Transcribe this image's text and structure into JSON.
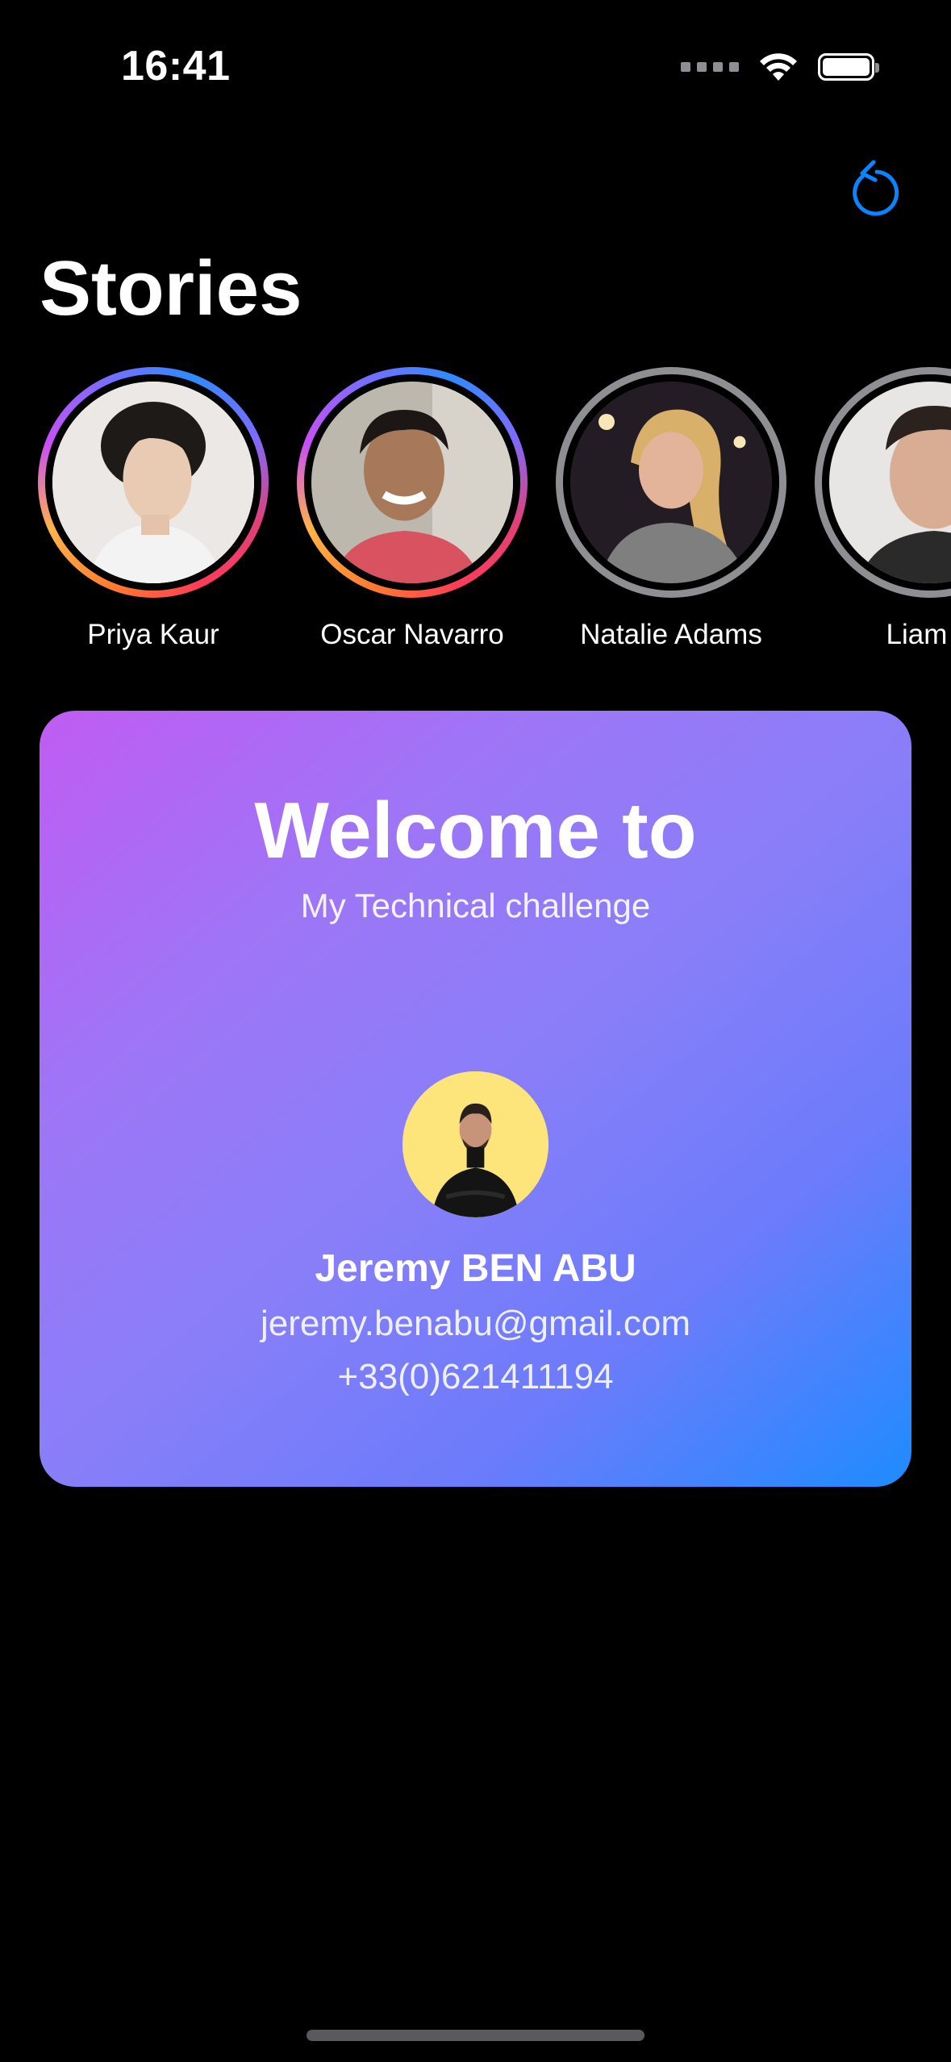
{
  "status_bar": {
    "time": "16:41"
  },
  "header": {
    "refresh_icon": "arrow-counterclockwise-icon",
    "title": "Stories"
  },
  "stories": [
    {
      "name": "Priya Kaur",
      "seen": false
    },
    {
      "name": "Oscar Navarro",
      "seen": false
    },
    {
      "name": "Natalie Adams",
      "seen": true
    },
    {
      "name": "Liam P",
      "seen": true
    }
  ],
  "welcome_card": {
    "title": "Welcome to",
    "subtitle": "My Technical challenge",
    "profile": {
      "name": "Jeremy BEN ABU",
      "email": "jeremy.benabu@gmail.com",
      "phone": "+33(0)621411194"
    }
  },
  "colors": {
    "background": "#000000",
    "accent": "#0a84ff",
    "card_gradient_start": "#c05cf2",
    "card_gradient_end": "#1e8bff",
    "profile_bg": "#fde47b",
    "seen_ring": "#8e8e93"
  }
}
